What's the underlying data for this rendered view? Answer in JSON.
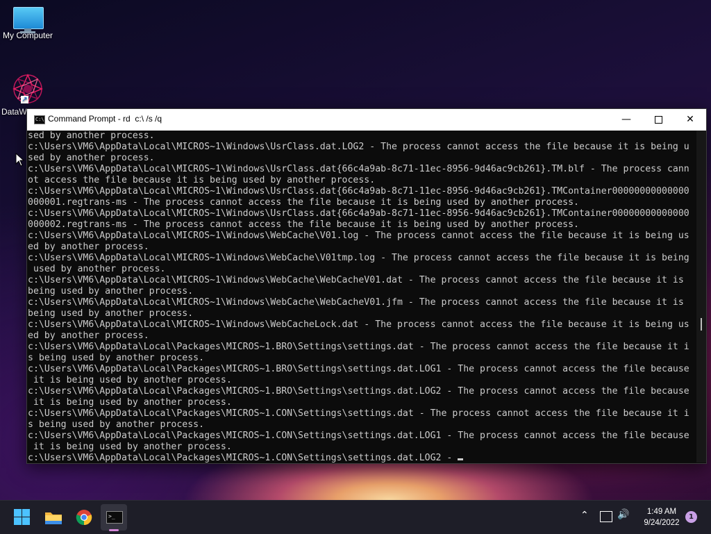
{
  "desktop": {
    "icons": [
      {
        "label": "My Computer",
        "icon": "monitor-icon"
      },
      {
        "label": "DataW",
        "icon": "datawrapper-icon"
      }
    ]
  },
  "window": {
    "title": "Command Prompt - rd  c:\\ /s /q",
    "icon": "cmd-icon",
    "controls": {
      "minimize": "minimize-icon",
      "maximize": "maximize-icon",
      "close": "close-icon"
    }
  },
  "console": {
    "lines": [
      "sed by another process.",
      "c:\\Users\\VM6\\AppData\\Local\\MICROS~1\\Windows\\UsrClass.dat.LOG2 - The process cannot access the file because it is being u",
      "sed by another process.",
      "c:\\Users\\VM6\\AppData\\Local\\MICROS~1\\Windows\\UsrClass.dat{66c4a9ab-8c71-11ec-8956-9d46ac9cb261}.TM.blf - The process cann",
      "ot access the file because it is being used by another process.",
      "c:\\Users\\VM6\\AppData\\Local\\MICROS~1\\Windows\\UsrClass.dat{66c4a9ab-8c71-11ec-8956-9d46ac9cb261}.TMContainer00000000000000",
      "000001.regtrans-ms - The process cannot access the file because it is being used by another process.",
      "c:\\Users\\VM6\\AppData\\Local\\MICROS~1\\Windows\\UsrClass.dat{66c4a9ab-8c71-11ec-8956-9d46ac9cb261}.TMContainer00000000000000",
      "000002.regtrans-ms - The process cannot access the file because it is being used by another process.",
      "c:\\Users\\VM6\\AppData\\Local\\MICROS~1\\Windows\\WebCache\\V01.log - The process cannot access the file because it is being us",
      "ed by another process.",
      "c:\\Users\\VM6\\AppData\\Local\\MICROS~1\\Windows\\WebCache\\V01tmp.log - The process cannot access the file because it is being",
      " used by another process.",
      "c:\\Users\\VM6\\AppData\\Local\\MICROS~1\\Windows\\WebCache\\WebCacheV01.dat - The process cannot access the file because it is",
      "being used by another process.",
      "c:\\Users\\VM6\\AppData\\Local\\MICROS~1\\Windows\\WebCache\\WebCacheV01.jfm - The process cannot access the file because it is",
      "being used by another process.",
      "c:\\Users\\VM6\\AppData\\Local\\MICROS~1\\Windows\\WebCacheLock.dat - The process cannot access the file because it is being us",
      "ed by another process.",
      "c:\\Users\\VM6\\AppData\\Local\\Packages\\MICROS~1.BRO\\Settings\\settings.dat - The process cannot access the file because it i",
      "s being used by another process.",
      "c:\\Users\\VM6\\AppData\\Local\\Packages\\MICROS~1.BRO\\Settings\\settings.dat.LOG1 - The process cannot access the file because",
      " it is being used by another process.",
      "c:\\Users\\VM6\\AppData\\Local\\Packages\\MICROS~1.BRO\\Settings\\settings.dat.LOG2 - The process cannot access the file because",
      " it is being used by another process.",
      "c:\\Users\\VM6\\AppData\\Local\\Packages\\MICROS~1.CON\\Settings\\settings.dat - The process cannot access the file because it i",
      "s being used by another process.",
      "c:\\Users\\VM6\\AppData\\Local\\Packages\\MICROS~1.CON\\Settings\\settings.dat.LOG1 - The process cannot access the file because",
      " it is being used by another process."
    ],
    "current_line": "c:\\Users\\VM6\\AppData\\Local\\Packages\\MICROS~1.CON\\Settings\\settings.dat.LOG2 - "
  },
  "taskbar": {
    "apps": [
      {
        "name": "start",
        "icon": "windows-start-icon"
      },
      {
        "name": "file-explorer",
        "icon": "folder-icon"
      },
      {
        "name": "chrome",
        "icon": "chrome-icon"
      },
      {
        "name": "command-prompt",
        "icon": "cmd-icon",
        "active": true
      }
    ],
    "tray": {
      "chevron_icon": "chevron-up-icon",
      "network_icon": "network-icon",
      "volume_icon": "speaker-icon",
      "time": "1:49 AM",
      "date": "9/24/2022",
      "notification_count": "1"
    }
  },
  "colors": {
    "console_bg": "#0c0c0c",
    "console_fg": "#cccccc",
    "taskbar_bg": "#1e1e28",
    "accent": "#4cc2ff"
  }
}
